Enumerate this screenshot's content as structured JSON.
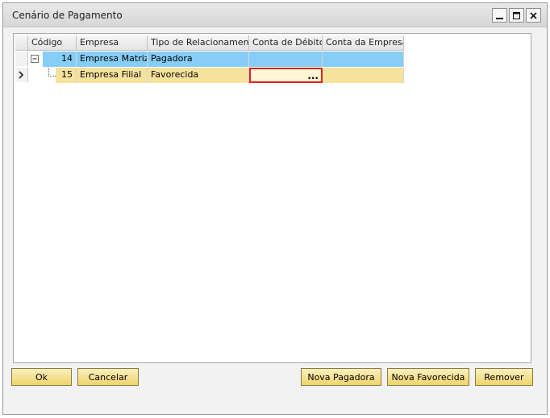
{
  "window": {
    "title": "Cenário de Pagamento"
  },
  "grid": {
    "columns": [
      "Código",
      "Empresa",
      "Tipo de Relacionamento",
      "Conta de Débito",
      "Conta da Empresa"
    ],
    "rows": [
      {
        "codigo": "14",
        "empresa": "Empresa Matriz",
        "tipo": "Pagadora",
        "conta_debito": "",
        "conta_empresa": "",
        "tree_toggle": "minus"
      },
      {
        "codigo": "15",
        "empresa": "Empresa Filial",
        "tipo": "Favorecida",
        "conta_debito": "",
        "conta_empresa": "",
        "current_row": true
      }
    ],
    "active_cell_button": "..."
  },
  "buttons": {
    "ok": "Ok",
    "cancel": "Cancelar",
    "new_payer": "Nova Pagadora",
    "new_payee": "Nova Favorecida",
    "remove": "Remover"
  },
  "colors": {
    "row_parent": "#86cdf7",
    "row_child": "#f5e29c",
    "active_cell_border": "#e0201c",
    "button_fill": "#efd56b"
  },
  "icons": [
    "minimize-icon",
    "maximize-icon",
    "close-icon",
    "tree-collapse-icon",
    "row-pointer-icon",
    "ellipsis-icon"
  ]
}
